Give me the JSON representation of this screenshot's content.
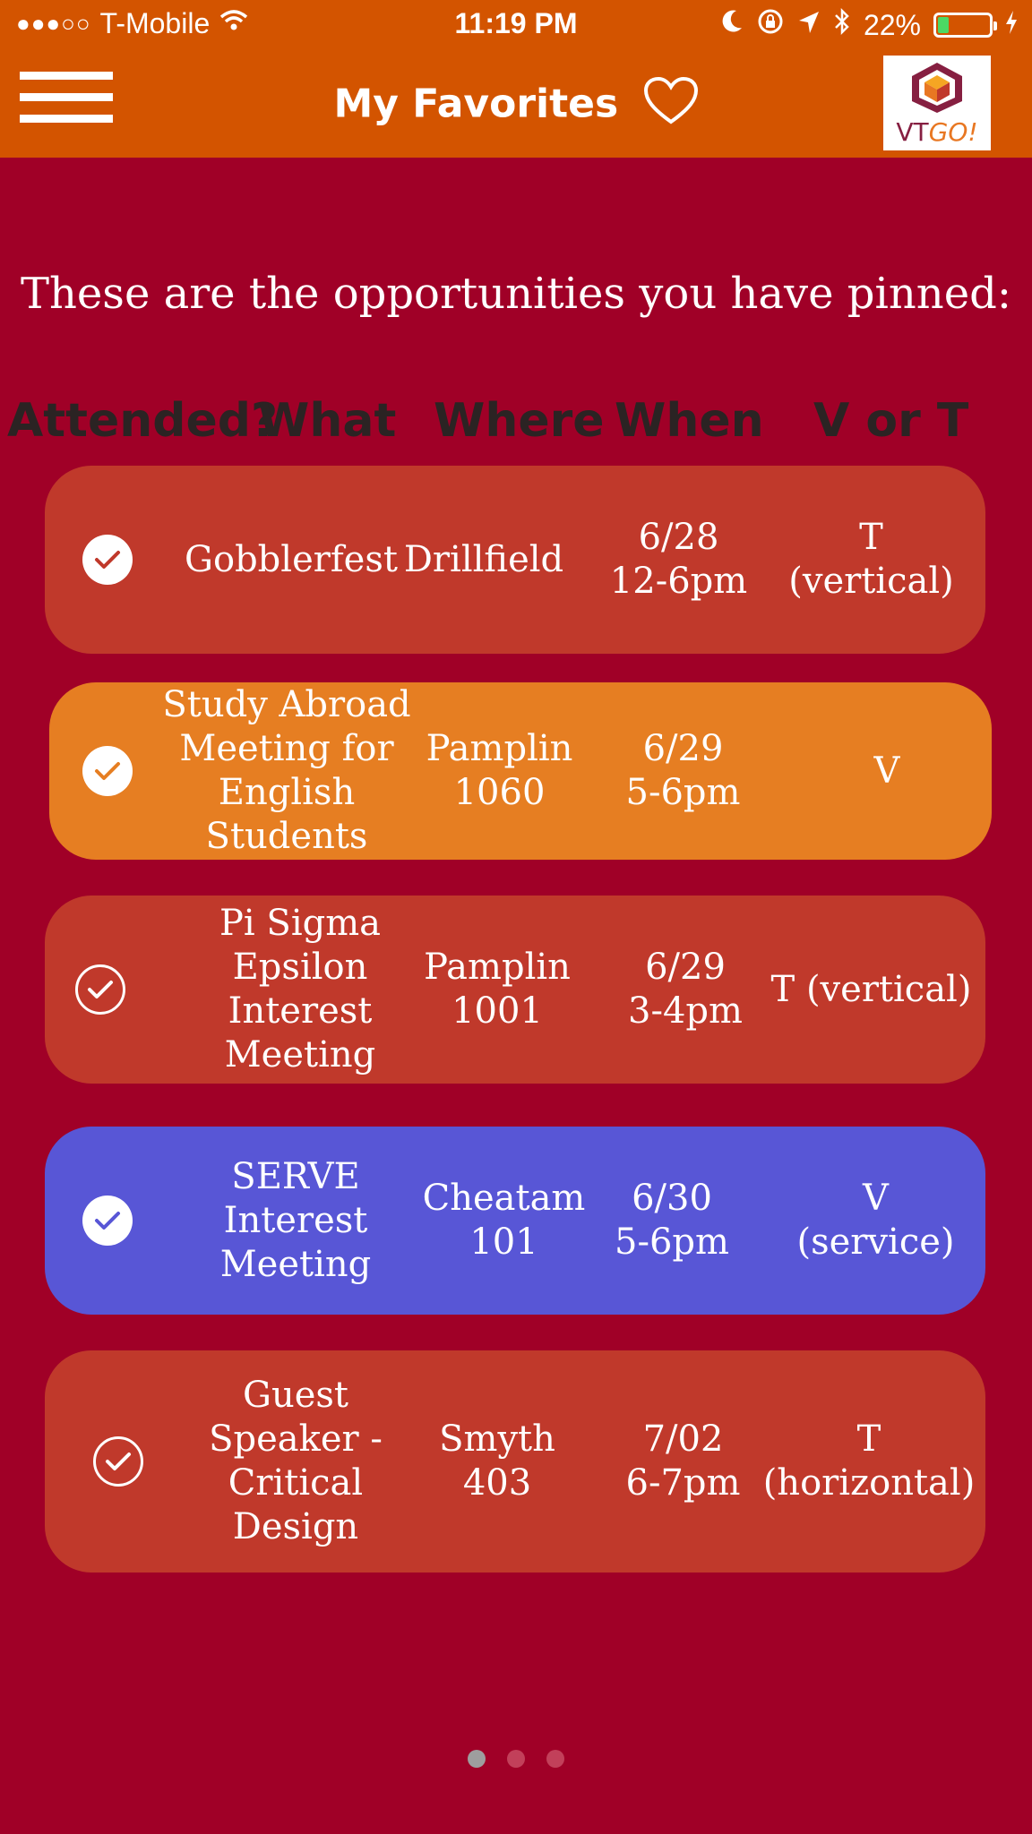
{
  "status_bar": {
    "signal": "●●●○○",
    "carrier": "T-Mobile",
    "time": "11:19 PM",
    "battery_percent": "22%",
    "battery_level": 0.22,
    "icons": [
      "wifi-icon",
      "moon-icon",
      "rotation-lock-icon",
      "location-arrow-icon",
      "bluetooth-icon",
      "battery-icon",
      "charging-bolt-icon"
    ]
  },
  "header": {
    "title": "My Favorites",
    "menu_icon": "hamburger-menu-icon",
    "heart_icon": "heart-icon",
    "logo": {
      "text_vt": "VT",
      "text_go": "GO!"
    }
  },
  "intro": "These are the opportunities you have pinned:",
  "columns": {
    "attended": "Attended?",
    "what": "What",
    "where": "Where",
    "when": "When",
    "v_or_t": "V or T"
  },
  "rows": [
    {
      "what": "Gobblerfest",
      "where": "Drillfield",
      "date": "6/28",
      "time": "12-6pm",
      "vt": "T\n(vertical)",
      "color": "#c0392b",
      "check": "filled"
    },
    {
      "what": "Study Abroad\nMeeting for\nEnglish Students",
      "where": "Pamplin\n1060",
      "date": "6/29",
      "time": "5-6pm",
      "vt": "V",
      "color": "#e67e22",
      "check": "filled"
    },
    {
      "what": "Pi Sigma\nEpsilon\nInterest\nMeeting",
      "where": "Pamplin\n1001",
      "date": "6/29",
      "time": "3-4pm",
      "vt": "T (vertical)",
      "color": "#c0392b",
      "check": "outline"
    },
    {
      "what": "SERVE\nInterest\nMeeting",
      "where": "Cheatam\n101",
      "date": "6/30",
      "time": "5-6pm",
      "vt": "V (service)",
      "color": "#5856d6",
      "check": "filled"
    },
    {
      "what": "Guest\nSpeaker -\nCritical\nDesign",
      "where": "Smyth\n403",
      "date": "7/02",
      "time": "6-7pm",
      "vt": "T\n(horizontal)",
      "color": "#c0392b",
      "check": "outline"
    }
  ],
  "pagination": {
    "pages": 3,
    "current": 1
  }
}
